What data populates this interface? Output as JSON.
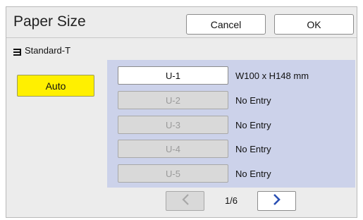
{
  "header": {
    "title": "Paper Size",
    "cancel_label": "Cancel",
    "ok_label": "OK"
  },
  "tray": {
    "icon": "paper-stack-icon",
    "label": "Standard-T"
  },
  "auto_button": {
    "label": "Auto",
    "color": "#fff000"
  },
  "sizes": [
    {
      "label": "U-1",
      "desc": "W100 x H148 mm",
      "enabled": true
    },
    {
      "label": "U-2",
      "desc": "No Entry",
      "enabled": false
    },
    {
      "label": "U-3",
      "desc": "No Entry",
      "enabled": false
    },
    {
      "label": "U-4",
      "desc": "No Entry",
      "enabled": false
    },
    {
      "label": "U-5",
      "desc": "No Entry",
      "enabled": false
    }
  ],
  "pager": {
    "indicator": "1/6",
    "prev_icon": "chevron-left-icon",
    "next_icon": "chevron-right-icon",
    "prev_enabled": false,
    "next_enabled": true,
    "accent": "#2a4fb3"
  },
  "colors": {
    "list_panel": "#ccd2ea"
  }
}
